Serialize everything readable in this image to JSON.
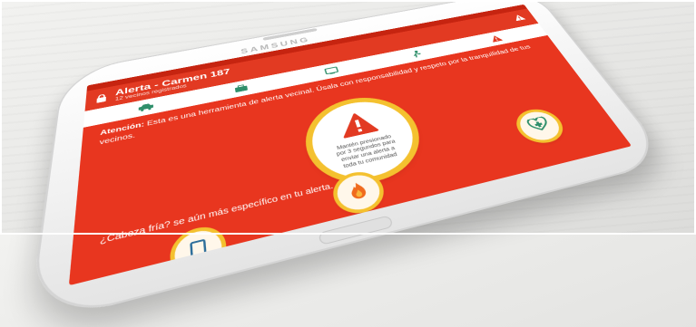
{
  "device": {
    "brand": "SAMSUNG"
  },
  "app": {
    "title": "Alerta - Carmen 187",
    "subtitle": "12 vecinos registrados",
    "accent_color": "#e8361f",
    "ring_color": "#f4c12f"
  },
  "toolbar": {
    "icons": [
      "car-icon",
      "briefcase-icon",
      "tv-icon",
      "person-icon",
      "warning-icon"
    ]
  },
  "notice": {
    "lead": "Atención:",
    "body": "Esta es una herramienta de alerta vecinal. Úsala con responsabilidad y respeto por la tranquilidad de tus vecinos."
  },
  "panic_button": {
    "icon": "warning-triangle-icon",
    "text": "Mantén presionado por 3 segundos para enviar una alerta a toda tu comunidad"
  },
  "question": "¿Cabeza fría? se aún más específico en tu alerta.",
  "quick_buttons": [
    {
      "name": "fire-alert-button",
      "icon": "flame-icon"
    },
    {
      "name": "medical-alert-button",
      "icon": "health-icon"
    },
    {
      "name": "other-alert-button",
      "icon": "tablet-icon"
    }
  ]
}
